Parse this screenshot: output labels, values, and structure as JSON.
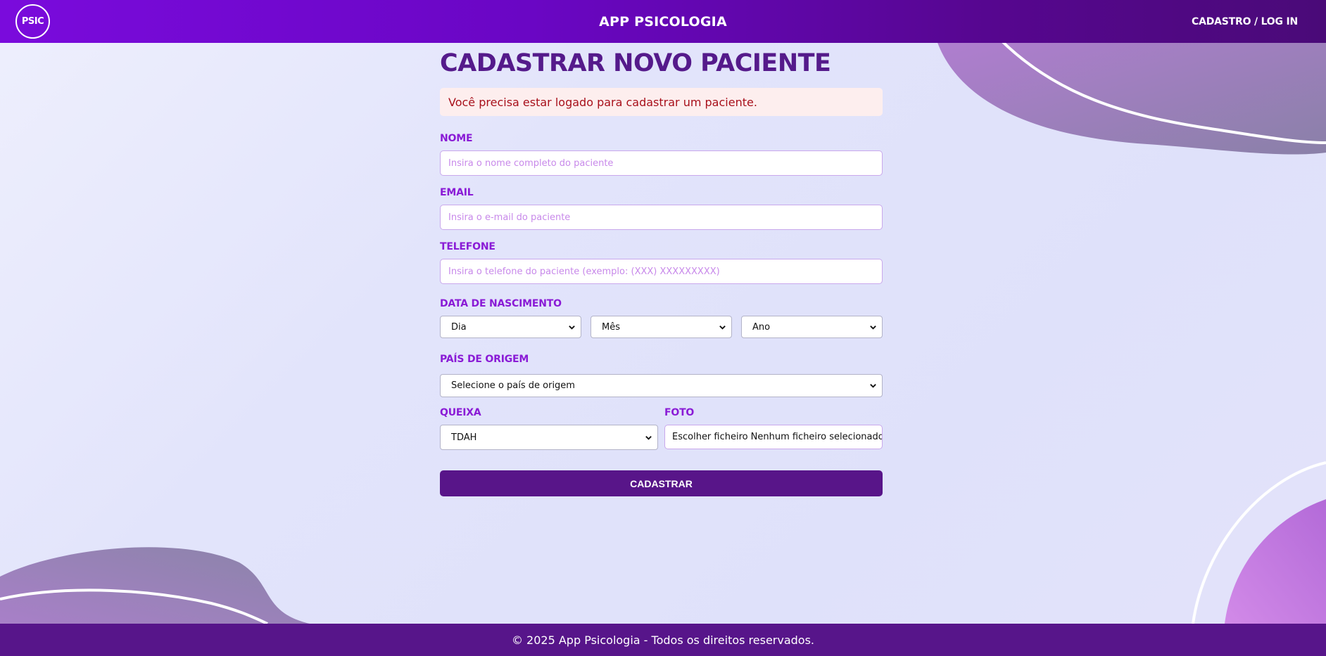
{
  "header": {
    "logo_text": "PSIC",
    "app_title": "APP PSICOLOGIA",
    "nav_link": "CADASTRO / LOG IN"
  },
  "page": {
    "title": "CADASTRAR NOVO PACIENTE",
    "alert": "Você precisa estar logado para cadastrar um paciente."
  },
  "form": {
    "nome": {
      "label": "NOME",
      "placeholder": "Insira o nome completo do paciente"
    },
    "email": {
      "label": "EMAIL",
      "placeholder": "Insira o e-mail do paciente"
    },
    "telefone": {
      "label": "TELEFONE",
      "placeholder": "Insira o telefone do paciente (exemplo: (XXX) XXXXXXXXX)"
    },
    "nascimento": {
      "label": "DATA DE NASCIMENTO",
      "dia": "Dia",
      "mes": "Mês",
      "ano": "Ano"
    },
    "pais": {
      "label": "PAÍS DE ORIGEM",
      "selected": "Selecione o país de origem"
    },
    "queixa": {
      "label": "QUEIXA",
      "selected": "TDAH"
    },
    "foto": {
      "label": "FOTO",
      "button": "Escolher ficheiro",
      "status": "Nenhum ficheiro selecionado"
    },
    "submit": "CADASTRAR"
  },
  "footer": {
    "text": "© 2025 App Psicologia - Todos os direitos reservados."
  },
  "colors": {
    "header_gradient_start": "#7a0bdc",
    "header_gradient_end": "#4a0a78",
    "accent": "#581589",
    "label": "#8a1bd6",
    "title": "#551a8b",
    "alert_bg": "#fdeeee",
    "alert_text": "#a8101b"
  },
  "icons": [
    "chevron-down-icon"
  ]
}
